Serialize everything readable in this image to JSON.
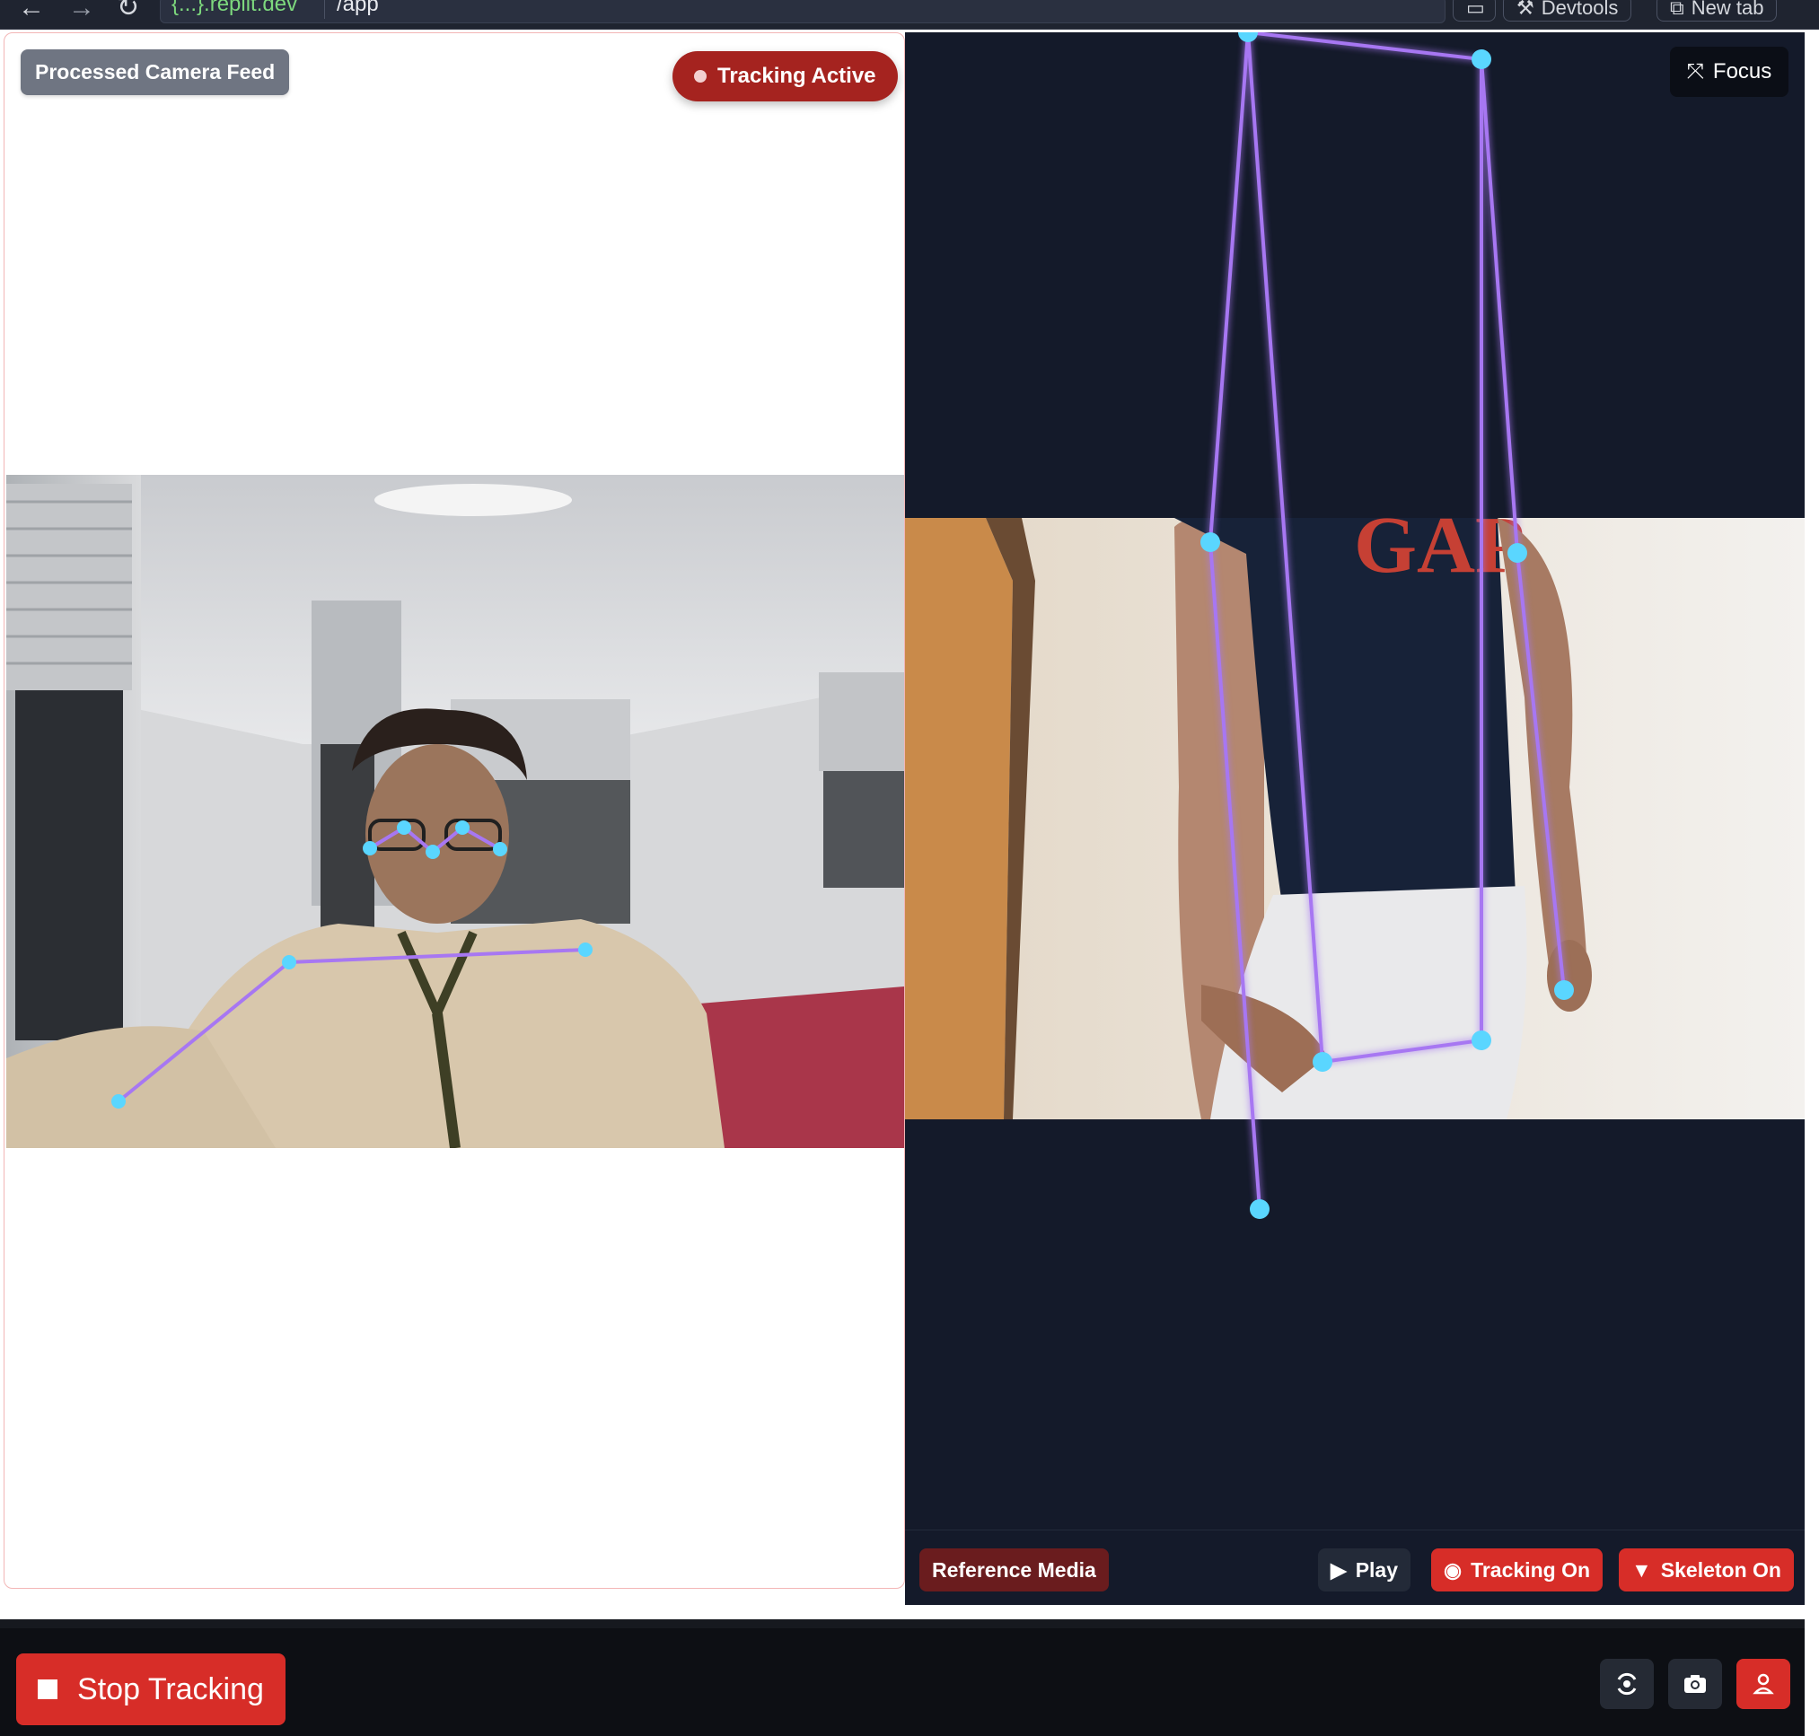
{
  "browser": {
    "url_domain": "{...}.replit.dev",
    "url_path": "/app",
    "devtools_label": "Devtools",
    "newtab_label": "New tab"
  },
  "left_panel": {
    "badge_label": "Processed Camera Feed",
    "status_label": "Tracking Active"
  },
  "right_panel": {
    "focus_label": "Focus",
    "reference_label": "Reference Media",
    "play_label": "Play",
    "tracking_label": "Tracking On",
    "skeleton_label": "Skeleton On"
  },
  "bottom_bar": {
    "stop_label": "Stop Tracking"
  },
  "colors": {
    "accent_red": "#d72d28",
    "dark_red": "#a5231f",
    "skeleton_line": "#a777f2",
    "skeleton_point": "#5ad6ff",
    "panel_dark": "#141a2a"
  },
  "icons": [
    "arrow-left-icon",
    "arrow-right-icon",
    "reload-icon",
    "monitor-icon",
    "wrench-icon",
    "external-tab-icon",
    "focus-icon",
    "play-icon",
    "eye-icon",
    "filter-icon",
    "stop-icon",
    "rotate-camera-icon",
    "camera-icon",
    "user-icon"
  ]
}
